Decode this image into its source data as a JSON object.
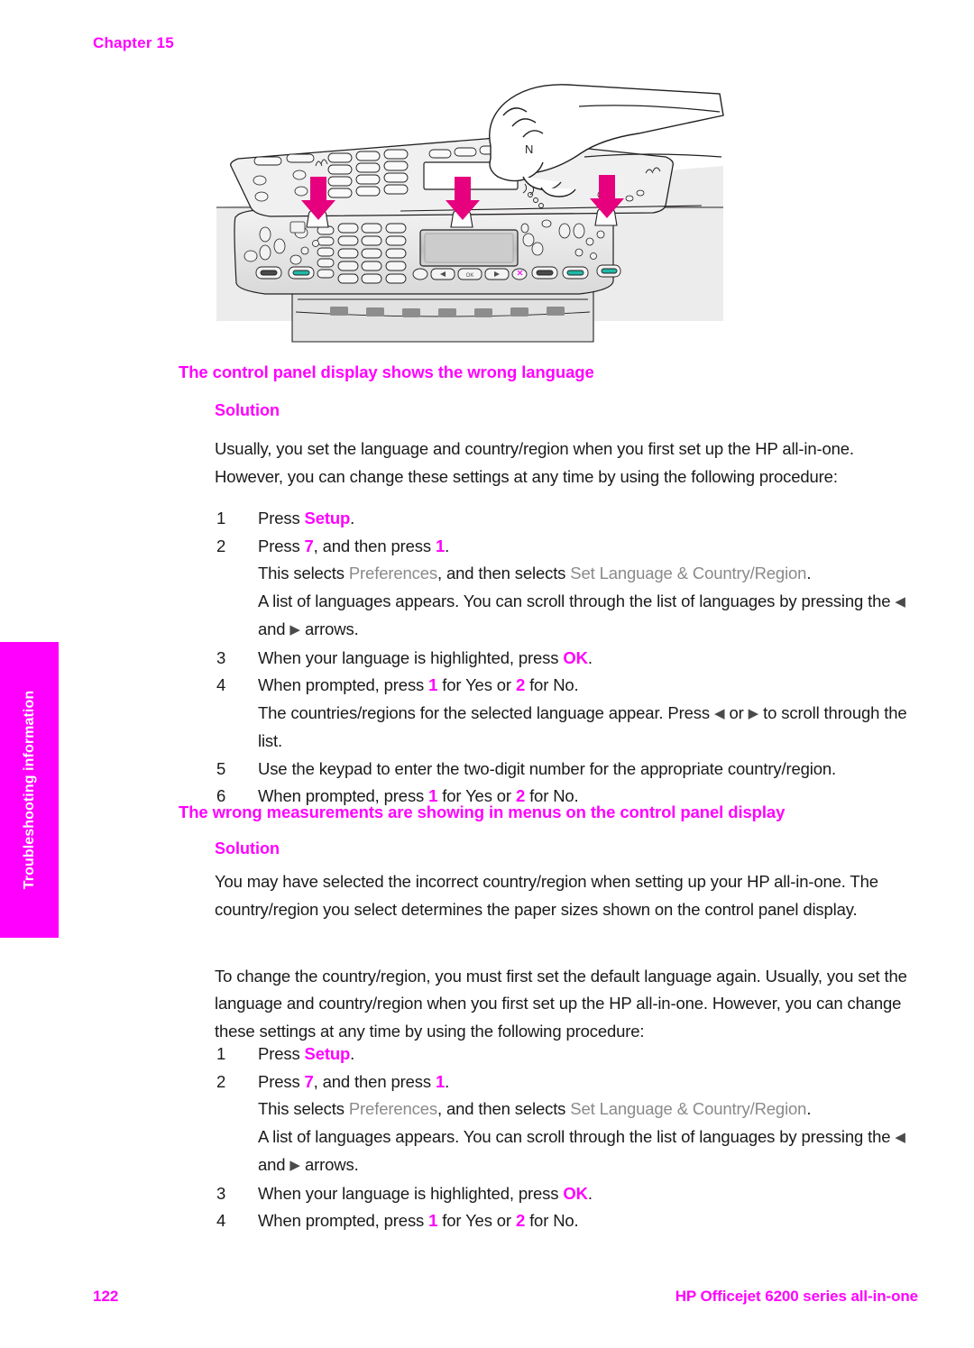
{
  "chapter": {
    "label": "Chapter 15"
  },
  "illustration": {
    "alt": "Hand pressing the control panel faceplate onto the HP all-in-one, with three downward arrows indicating press points",
    "arrow_color": "#e6007e",
    "arrow_count": 3
  },
  "side_tab": {
    "label": "Troubleshooting information",
    "background": "#ff00ff",
    "text_color": "#ffffff"
  },
  "colors": {
    "accent_magenta": "#ff00ff",
    "menu_term_gray": "#8a8a8a",
    "body_text": "#1a1a1a"
  },
  "sections": [
    {
      "heading": "The control panel display shows the wrong language",
      "solution_label": "Solution",
      "paragraphs": [
        "Usually, you set the language and country/region when you first set up the HP all-in-one. However, you can change these settings at any time by using the following procedure:"
      ],
      "steps": [
        {
          "num": "1",
          "parts": [
            {
              "t": "Press ",
              "s": "plain"
            },
            {
              "t": "Setup",
              "s": "accent"
            },
            {
              "t": ".",
              "s": "plain"
            }
          ]
        },
        {
          "num": "2",
          "parts": [
            {
              "t": "Press ",
              "s": "plain"
            },
            {
              "t": "7",
              "s": "accent"
            },
            {
              "t": ", and then press ",
              "s": "plain"
            },
            {
              "t": "1",
              "s": "accent"
            },
            {
              "t": ".",
              "s": "plain"
            }
          ],
          "sub": [
            {
              "parts": [
                {
                  "t": "This selects ",
                  "s": "plain"
                },
                {
                  "t": "Preferences",
                  "s": "menu"
                },
                {
                  "t": ", and then selects ",
                  "s": "plain"
                },
                {
                  "t": "Set Language & Country/Region",
                  "s": "menu"
                },
                {
                  "t": ".",
                  "s": "plain"
                }
              ]
            },
            {
              "parts": [
                {
                  "t": "A list of languages appears. You can scroll through the list of languages by pressing the ",
                  "s": "plain"
                },
                {
                  "t": "◀",
                  "s": "arrow"
                },
                {
                  "t": " and ",
                  "s": "plain"
                },
                {
                  "t": "▶",
                  "s": "arrow"
                },
                {
                  "t": " arrows.",
                  "s": "plain"
                }
              ]
            }
          ]
        },
        {
          "num": "3",
          "parts": [
            {
              "t": "When your language is highlighted, press ",
              "s": "plain"
            },
            {
              "t": "OK",
              "s": "accent"
            },
            {
              "t": ".",
              "s": "plain"
            }
          ]
        },
        {
          "num": "4",
          "parts": [
            {
              "t": "When prompted, press ",
              "s": "plain"
            },
            {
              "t": "1",
              "s": "accent"
            },
            {
              "t": " for Yes or ",
              "s": "plain"
            },
            {
              "t": "2",
              "s": "accent"
            },
            {
              "t": " for No.",
              "s": "plain"
            }
          ],
          "sub": [
            {
              "parts": [
                {
                  "t": "The countries/regions for the selected language appear. Press ",
                  "s": "plain"
                },
                {
                  "t": "◀",
                  "s": "arrow"
                },
                {
                  "t": " or ",
                  "s": "plain"
                },
                {
                  "t": "▶",
                  "s": "arrow"
                },
                {
                  "t": " to scroll through the list.",
                  "s": "plain"
                }
              ]
            }
          ]
        },
        {
          "num": "5",
          "parts": [
            {
              "t": "Use the keypad to enter the two-digit number for the appropriate country/region.",
              "s": "plain"
            }
          ]
        },
        {
          "num": "6",
          "parts": [
            {
              "t": "When prompted, press ",
              "s": "plain"
            },
            {
              "t": "1",
              "s": "accent"
            },
            {
              "t": " for Yes or ",
              "s": "plain"
            },
            {
              "t": "2",
              "s": "accent"
            },
            {
              "t": " for No.",
              "s": "plain"
            }
          ]
        }
      ]
    },
    {
      "heading": "The wrong measurements are showing in menus on the control panel display",
      "solution_label": "Solution",
      "paragraphs": [
        "You may have selected the incorrect country/region when setting up your HP all-in-one. The country/region you select determines the paper sizes shown on the control panel display.",
        "To change the country/region, you must first set the default language again. Usually, you set the language and country/region when you first set up the HP all-in-one. However, you can change these settings at any time by using the following procedure:"
      ],
      "steps": [
        {
          "num": "1",
          "parts": [
            {
              "t": "Press ",
              "s": "plain"
            },
            {
              "t": "Setup",
              "s": "accent"
            },
            {
              "t": ".",
              "s": "plain"
            }
          ]
        },
        {
          "num": "2",
          "parts": [
            {
              "t": "Press ",
              "s": "plain"
            },
            {
              "t": "7",
              "s": "accent"
            },
            {
              "t": ", and then press ",
              "s": "plain"
            },
            {
              "t": "1",
              "s": "accent"
            },
            {
              "t": ".",
              "s": "plain"
            }
          ],
          "sub": [
            {
              "parts": [
                {
                  "t": "This selects ",
                  "s": "plain"
                },
                {
                  "t": "Preferences",
                  "s": "menu"
                },
                {
                  "t": ", and then selects ",
                  "s": "plain"
                },
                {
                  "t": "Set Language & Country/Region",
                  "s": "menu"
                },
                {
                  "t": ".",
                  "s": "plain"
                }
              ]
            },
            {
              "parts": [
                {
                  "t": "A list of languages appears. You can scroll through the list of languages by pressing the ",
                  "s": "plain"
                },
                {
                  "t": "◀",
                  "s": "arrow"
                },
                {
                  "t": " and ",
                  "s": "plain"
                },
                {
                  "t": "▶",
                  "s": "arrow"
                },
                {
                  "t": " arrows.",
                  "s": "plain"
                }
              ]
            }
          ]
        },
        {
          "num": "3",
          "parts": [
            {
              "t": "When your language is highlighted, press ",
              "s": "plain"
            },
            {
              "t": "OK",
              "s": "accent"
            },
            {
              "t": ".",
              "s": "plain"
            }
          ]
        },
        {
          "num": "4",
          "parts": [
            {
              "t": "When prompted, press ",
              "s": "plain"
            },
            {
              "t": "1",
              "s": "accent"
            },
            {
              "t": " for Yes or ",
              "s": "plain"
            },
            {
              "t": "2",
              "s": "accent"
            },
            {
              "t": " for No.",
              "s": "plain"
            }
          ]
        }
      ]
    }
  ],
  "footer": {
    "page_number": "122",
    "product": "HP Officejet 6200 series all-in-one"
  }
}
